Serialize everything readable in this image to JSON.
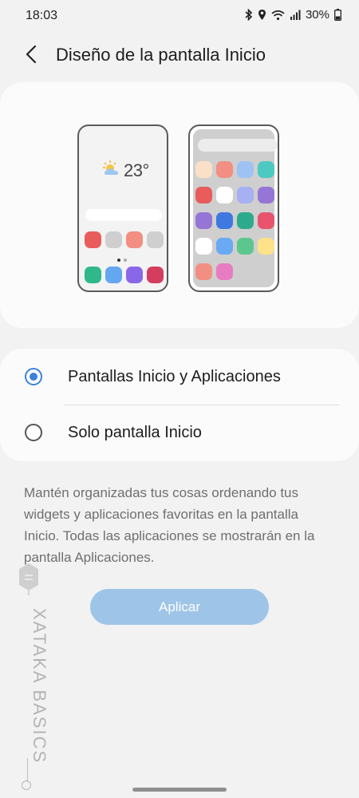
{
  "status_bar": {
    "time": "18:03",
    "battery": "30%"
  },
  "header": {
    "title": "Diseño de la pantalla Inicio"
  },
  "preview": {
    "weather_temp": "23°",
    "home_screen_app_colors": [
      "#e85c5c",
      "#cfcfcf",
      "#f28f82",
      "#cfcfcf",
      "#2fb88a",
      "#64a6f0",
      "#8a67e8",
      "#d43d5e"
    ],
    "apps_screen_app_colors": [
      "#fbe0c8",
      "#f28f82",
      "#9fc2f5",
      "#4cc9c1",
      "#e85c5c",
      "#ffffff",
      "#a6b0f2",
      "#9575d6",
      "#9575d6",
      "#3f79e0",
      "#2bab8c",
      "#e8546e",
      "#ffffff",
      "#6aaaf5",
      "#5cc78d",
      "#fde28a",
      "#f28f82",
      "#e77cc2"
    ]
  },
  "options": [
    {
      "label": "Pantallas Inicio y Aplicaciones",
      "selected": true
    },
    {
      "label": "Solo pantalla Inicio",
      "selected": false
    }
  ],
  "description": "Mantén organizadas tus cosas ordenando tus widgets y aplicaciones favoritas en la pantalla Inicio. Todas las aplicaciones se mostrarán en la pantalla Aplicaciones.",
  "apply_button": {
    "label": "Aplicar"
  },
  "watermark": {
    "text": "XATAKA BASICS"
  },
  "colors": {
    "accent": "#3b82db",
    "apply_button_bg": "#9ec5e8",
    "background": "#f2f2f2",
    "card": "#fbfbfb"
  }
}
